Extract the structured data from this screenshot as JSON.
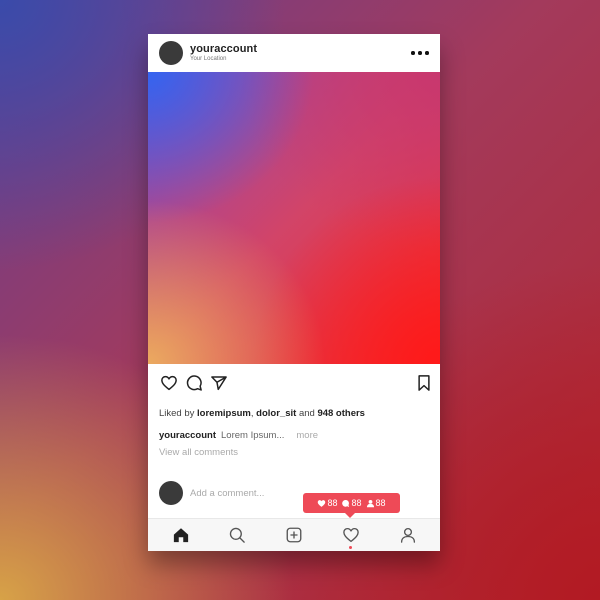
{
  "post": {
    "username": "youraccount",
    "location": "Your Location"
  },
  "likes": {
    "prefix": "Liked by",
    "user1": "loremipsum",
    "sep": ",",
    "user2": "dolor_sit",
    "and": "and",
    "others": "948 others"
  },
  "caption": {
    "username": "youraccount",
    "text": "Lorem Ipsum...",
    "more": "more"
  },
  "comments": {
    "view_all": "View all comments",
    "placeholder": "Add a comment..."
  },
  "notification": {
    "likes": "88",
    "comments": "88",
    "follows": "88",
    "color": "#ee4a57"
  },
  "nav": {
    "items": [
      "home-icon",
      "search-icon",
      "add-post-icon",
      "activity-heart-icon",
      "profile-icon"
    ],
    "active": "home-icon"
  },
  "icons": {
    "more": "more-options-icon",
    "like": "heart-icon",
    "comment": "comment-icon",
    "share": "send-icon",
    "save": "bookmark-icon"
  },
  "colors": {
    "accent": "#ee4a57",
    "avatar": "#3a3a3a"
  }
}
